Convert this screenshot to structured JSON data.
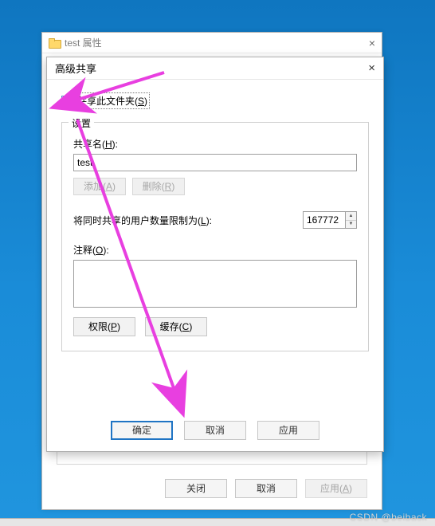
{
  "desktop": {
    "watermark": "CSDN @beiback"
  },
  "props": {
    "title": "test 属性",
    "buttons": {
      "close": "关闭",
      "cancel": "取消",
      "apply": "应用(A)"
    }
  },
  "adv": {
    "title": "高级共享",
    "share_checkbox_label": "共享此文件夹(S)",
    "share_checked": true,
    "group_legend": "设置",
    "share_name_label": "共享名(H):",
    "share_name_value": "test",
    "add_btn": "添加(A)",
    "remove_btn": "删除(R)",
    "limit_label": "将同时共享的用户数量限制为(L):",
    "limit_value": "167772",
    "comment_label": "注释(O):",
    "comment_value": "",
    "permissions_btn": "权限(P)",
    "cache_btn": "缓存(C)",
    "buttons": {
      "ok": "确定",
      "cancel": "取消",
      "apply": "应用"
    }
  }
}
